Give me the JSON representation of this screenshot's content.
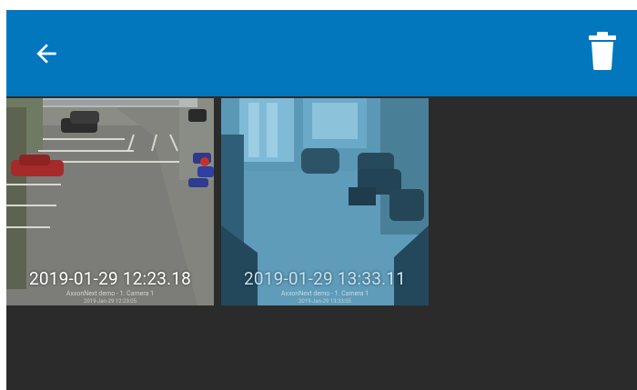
{
  "appbar": {
    "back_icon": "arrow-back-icon",
    "delete_icon": "trash-icon",
    "color": "#0277bd"
  },
  "colors": {
    "background": "#2b2b2b"
  },
  "thumbnails": [
    {
      "timestamp": "2019-01-29 12:23.18",
      "camera_label": "AxxonNext demo - 1. Camera 1",
      "camera_sub": "2019-Jan-29 12:23:05",
      "scene": "parking-lot"
    },
    {
      "timestamp": "2019-01-29 13:33.11",
      "camera_label": "AxxonNext demo - 1. Camera 1",
      "camera_sub": "2019-Jan-29 13:33:05",
      "scene": "lobby",
      "selected": true
    }
  ]
}
